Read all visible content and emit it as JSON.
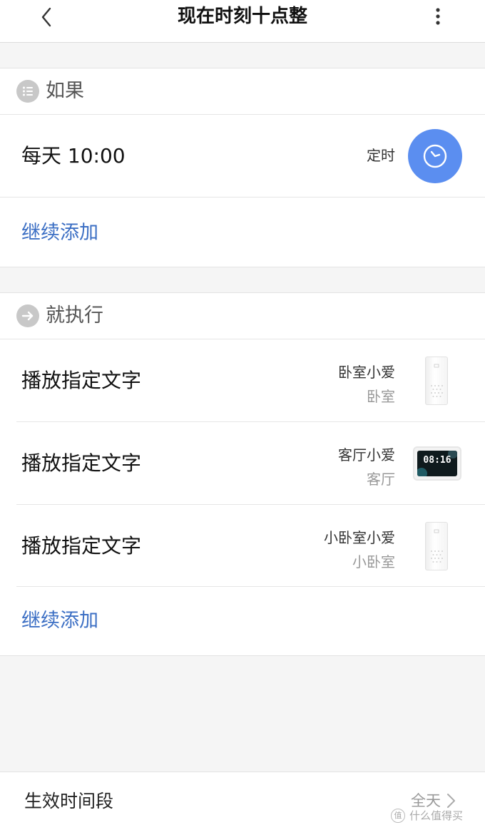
{
  "header": {
    "title": "现在时刻十点整"
  },
  "if_section": {
    "title": "如果",
    "trigger": {
      "label": "每天 10:00",
      "type_label": "定时"
    },
    "add_label": "继续添加"
  },
  "then_section": {
    "title": "就执行",
    "actions": [
      {
        "label": "播放指定文字",
        "device": "卧室小爱",
        "room": "卧室",
        "device_kind": "speaker"
      },
      {
        "label": "播放指定文字",
        "device": "客厅小爱",
        "room": "客厅",
        "device_kind": "touchscreen",
        "screen_time": "08:16"
      },
      {
        "label": "播放指定文字",
        "device": "小卧室小爱",
        "room": "小卧室",
        "device_kind": "speaker"
      }
    ],
    "add_label": "继续添加"
  },
  "bottom": {
    "label": "生效时间段",
    "value": "全天"
  },
  "watermark": {
    "badge": "值",
    "text": "什么值得买"
  },
  "colors": {
    "accent_blue": "#5b8ef0",
    "link_blue": "#3c6fc4",
    "section_icon_gray": "#c8c8c8",
    "background": "#f5f5f5"
  },
  "icons": [
    "back-icon",
    "more-icon",
    "list-icon",
    "clock-icon",
    "arrow-right-icon",
    "chevron-right-icon"
  ]
}
